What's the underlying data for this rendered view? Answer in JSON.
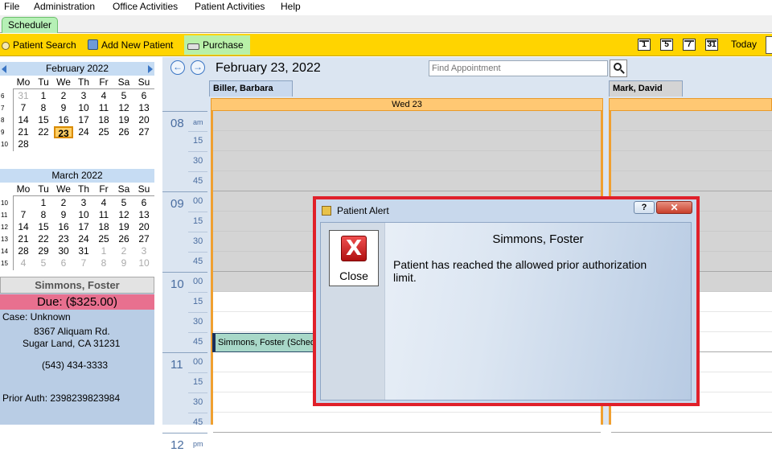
{
  "menu": [
    "File",
    "Administration",
    "Office Activities",
    "Patient Activities",
    "Help"
  ],
  "tabs": {
    "scheduler": "Scheduler"
  },
  "toolbar": {
    "patient_search": "Patient Search",
    "add_new_patient": "Add New Patient",
    "purchase": "Purchase",
    "view_buttons": [
      "1",
      "5",
      "7",
      "31"
    ],
    "today": "Today"
  },
  "calendars": [
    {
      "title": "February  2022",
      "dow": [
        "Mo",
        "Tu",
        "We",
        "Th",
        "Fr",
        "Sa",
        "Su"
      ],
      "weeks": [
        {
          "wk": "6",
          "days": [
            "31",
            "1",
            "2",
            "3",
            "4",
            "5",
            "6"
          ],
          "dim": [
            0
          ]
        },
        {
          "wk": "7",
          "days": [
            "7",
            "8",
            "9",
            "10",
            "11",
            "12",
            "13"
          ],
          "dim": []
        },
        {
          "wk": "8",
          "days": [
            "14",
            "15",
            "16",
            "17",
            "18",
            "19",
            "20"
          ],
          "dim": []
        },
        {
          "wk": "9",
          "days": [
            "21",
            "22",
            "23",
            "24",
            "25",
            "26",
            "27"
          ],
          "dim": [],
          "today": 2
        },
        {
          "wk": "10",
          "days": [
            "28",
            "",
            "",
            "",
            "",
            "",
            ""
          ],
          "dim": []
        }
      ]
    },
    {
      "title": "March  2022",
      "dow": [
        "Mo",
        "Tu",
        "We",
        "Th",
        "Fr",
        "Sa",
        "Su"
      ],
      "weeks": [
        {
          "wk": "10",
          "days": [
            "",
            "1",
            "2",
            "3",
            "4",
            "5",
            "6"
          ],
          "dim": []
        },
        {
          "wk": "11",
          "days": [
            "7",
            "8",
            "9",
            "10",
            "11",
            "12",
            "13"
          ],
          "dim": []
        },
        {
          "wk": "12",
          "days": [
            "14",
            "15",
            "16",
            "17",
            "18",
            "19",
            "20"
          ],
          "dim": []
        },
        {
          "wk": "13",
          "days": [
            "21",
            "22",
            "23",
            "24",
            "25",
            "26",
            "27"
          ],
          "dim": []
        },
        {
          "wk": "14",
          "days": [
            "28",
            "29",
            "30",
            "31",
            "1",
            "2",
            "3"
          ],
          "dim": [
            4,
            5,
            6
          ]
        },
        {
          "wk": "15",
          "days": [
            "4",
            "5",
            "6",
            "7",
            "8",
            "9",
            "10"
          ],
          "dim": [
            0,
            1,
            2,
            3,
            4,
            5,
            6
          ]
        }
      ]
    }
  ],
  "patient_card": {
    "name": "Simmons, Foster",
    "due": "Due: ($325.00)",
    "case": "Case: Unknown",
    "address1": "8367 Aliquam Rd.",
    "address2": "Sugar Land, CA 31231",
    "phone": "(543) 434-3333",
    "prior_auth": "Prior Auth: 2398239823984"
  },
  "scheduler": {
    "date_title": "February 23, 2022",
    "find_placeholder": "Find Appointment",
    "resources": [
      "Biller, Barbara",
      "Mark, David"
    ],
    "day_header": "Wed 23",
    "hours": [
      "08",
      "09",
      "10",
      "11",
      "12"
    ],
    "am_suffix": "am",
    "pm_suffix": "pm",
    "minutes": [
      "00",
      "15",
      "30",
      "45"
    ],
    "appointment": "Simmons, Foster (Scheduled)"
  },
  "dialog": {
    "title": "Patient Alert",
    "help": "?",
    "close_x": "✕",
    "close_button": "Close",
    "close_glyph": "X",
    "patient": "Simmons, Foster",
    "message": "Patient has reached the allowed prior authorization limit."
  },
  "colors": {
    "toolbar": "#ffd400",
    "purchase": "#b8f0a8",
    "due_banner": "#e8708f",
    "dialog_border": "#e0202a",
    "day_header": "#ffc873"
  }
}
